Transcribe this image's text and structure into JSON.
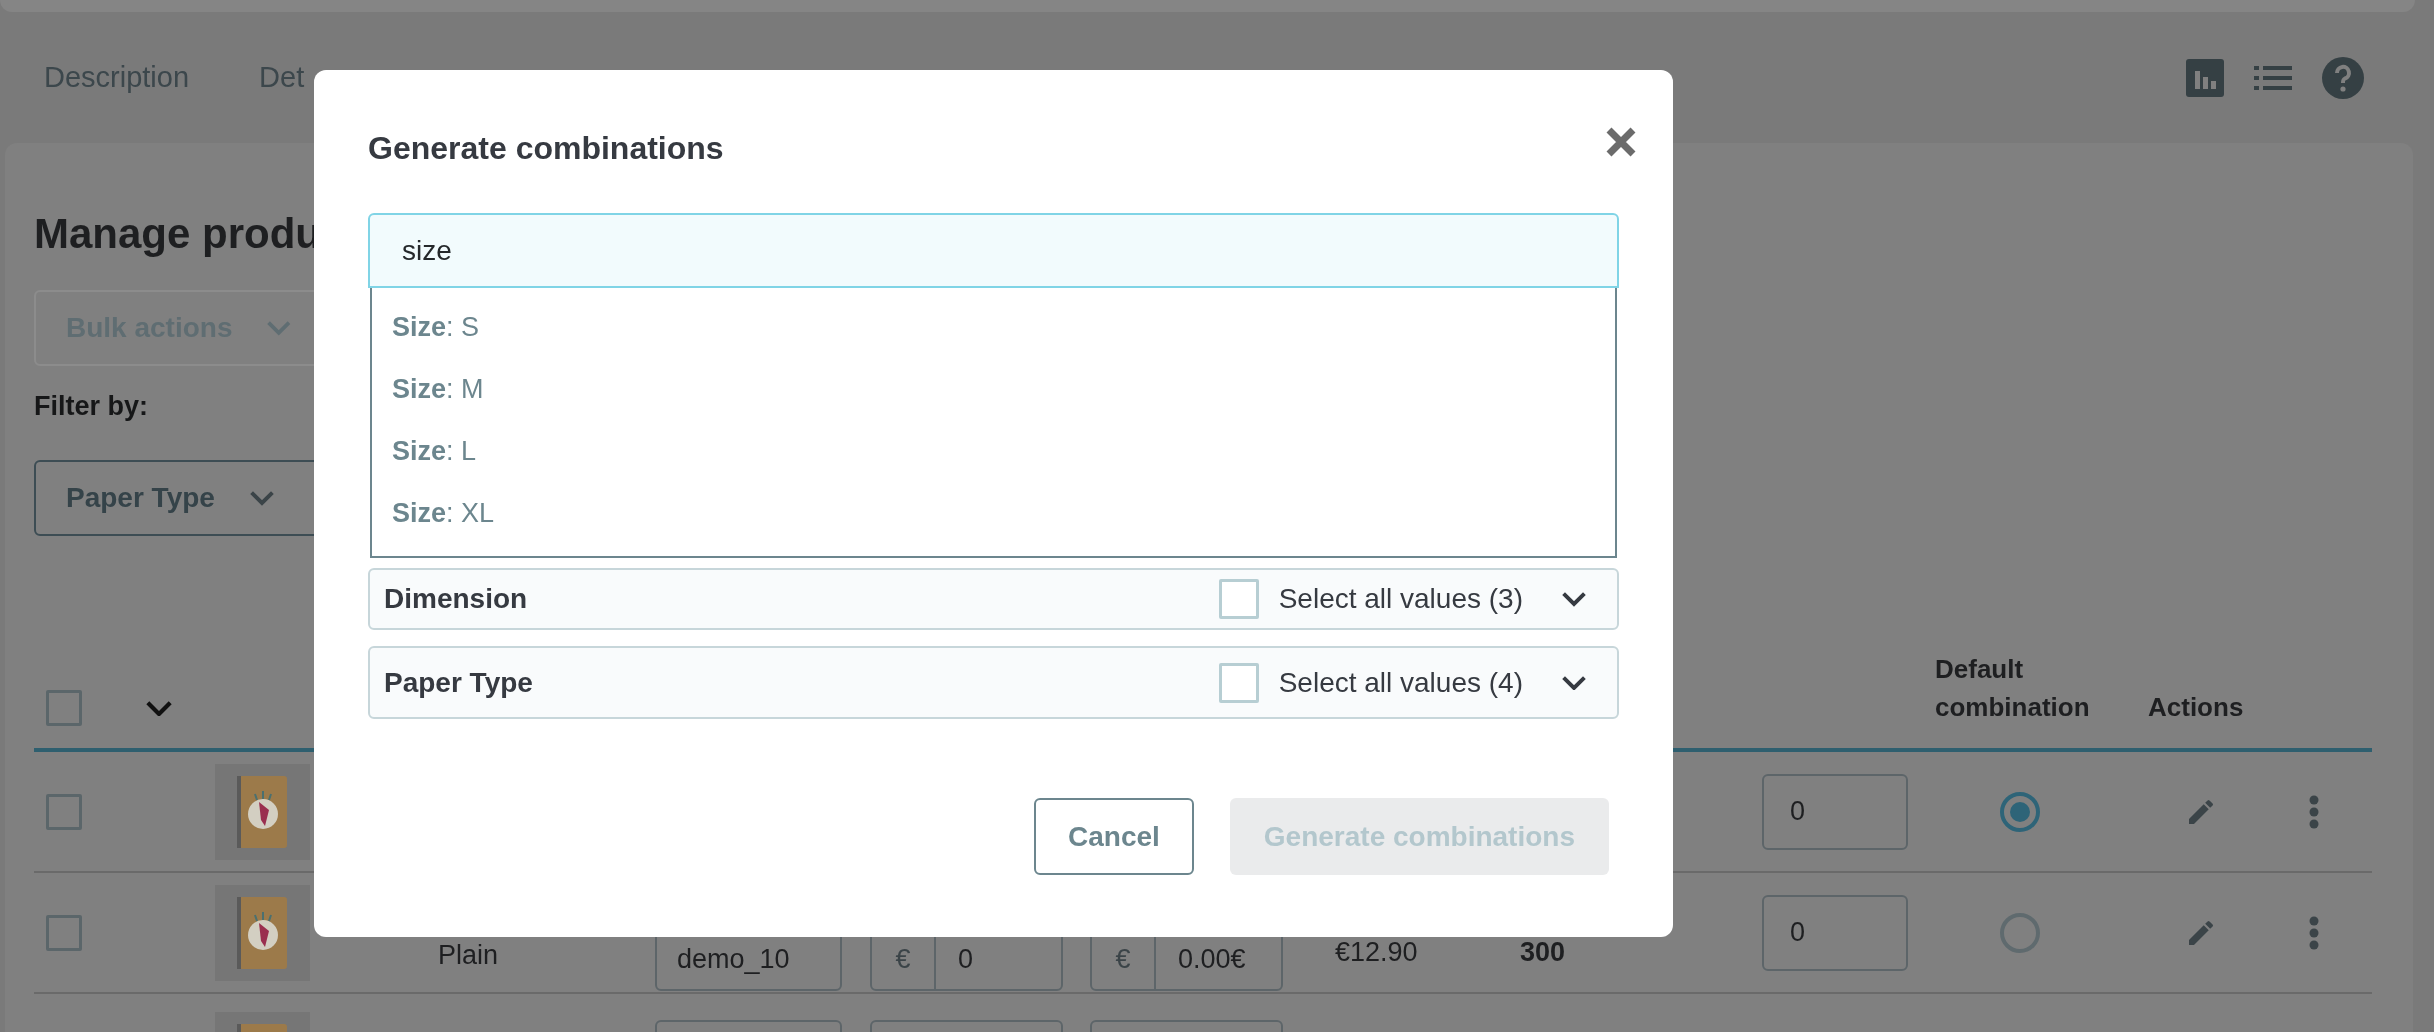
{
  "tabs": [
    {
      "label": "Description"
    },
    {
      "label": "Det"
    }
  ],
  "heading": "Manage produ",
  "bulk_actions": {
    "label": "Bulk actions",
    "disabled": true
  },
  "filter_label": "Filter by:",
  "filters": [
    {
      "label": "Paper Type"
    }
  ],
  "table": {
    "header_checked": false,
    "columns": [
      {
        "label": "Default combination"
      },
      {
        "label": "Actions"
      }
    ],
    "rows": [
      {
        "kind": "full",
        "checked": false,
        "quantity": "0",
        "selected": true
      },
      {
        "kind": "full",
        "checked": false,
        "name": "Plain",
        "reference": "demo_10",
        "impact_currency": "€",
        "impact": "0",
        "price_currency": "€",
        "price": "0.00€",
        "final_price": "€12.90",
        "stock": "300",
        "quantity": "0",
        "selected": false
      },
      {
        "kind": "cut"
      }
    ]
  },
  "modal": {
    "title": "Generate combinations",
    "search": {
      "value": "size"
    },
    "suggestions": [
      {
        "text": "**Size**: S"
      },
      {
        "text": "**Size**: M"
      },
      {
        "text": "**Size**: L"
      },
      {
        "text": "**Size**: XL"
      }
    ],
    "attributes": [
      {
        "name": "Dimension",
        "select_all": "Select all values (3)",
        "checked": false
      },
      {
        "name": "Paper Type",
        "select_all": "Select all values (4)",
        "checked": false
      }
    ],
    "buttons": [
      {
        "label": "Cancel",
        "kind": "secondary",
        "disabled": false
      },
      {
        "label": "Generate combinations",
        "kind": "primary",
        "disabled": true
      }
    ]
  }
}
